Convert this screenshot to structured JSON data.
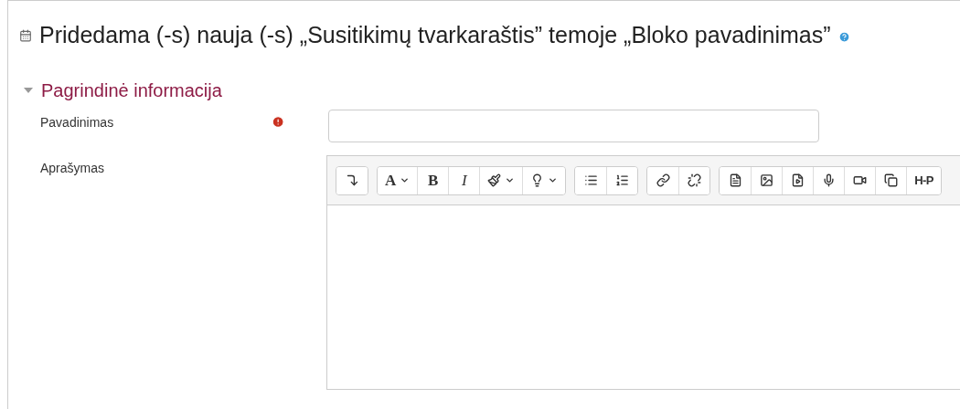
{
  "page_title": "Pridedama (-s) nauja (-s) „Susitikimų tvarkaraštis” temoje „Bloko pavadinimas”",
  "section": {
    "title": "Pagrindinė informacija"
  },
  "fields": [
    {
      "kind": "text",
      "label": "Pavadinimas",
      "required": true
    },
    {
      "kind": "editor",
      "label": "Aprašymas",
      "required": false
    }
  ],
  "toolbar_groups": [
    [
      {
        "kind": "icon"
      }
    ],
    [
      {
        "kind": "text",
        "label": "A"
      },
      {
        "kind": "text",
        "label": "B"
      },
      {
        "kind": "text",
        "label": "I"
      },
      {
        "kind": "icon"
      },
      {
        "kind": "icon"
      }
    ],
    [
      {
        "kind": "icon"
      },
      {
        "kind": "icon"
      }
    ],
    [
      {
        "kind": "icon"
      },
      {
        "kind": "icon"
      }
    ],
    [
      {
        "kind": "icon"
      },
      {
        "kind": "icon"
      },
      {
        "kind": "icon"
      },
      {
        "kind": "icon"
      },
      {
        "kind": "icon"
      },
      {
        "kind": "icon"
      },
      {
        "kind": "text",
        "label": "H-P"
      }
    ]
  ]
}
